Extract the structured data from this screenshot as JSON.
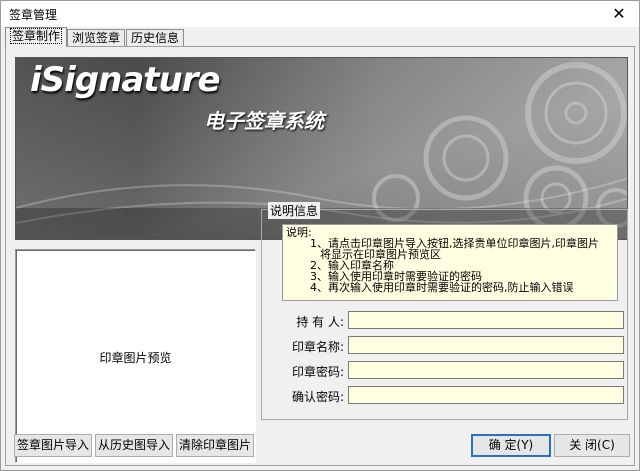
{
  "window": {
    "title": "签章管理",
    "close_glyph": "✕"
  },
  "tabs": [
    {
      "label": "签章制作",
      "active": true
    },
    {
      "label": "浏览签章",
      "active": false
    },
    {
      "label": "历史信息",
      "active": false
    }
  ],
  "banner": {
    "brand": "iSignature",
    "subtitle": "电子签章系统"
  },
  "preview": {
    "label": "印章图片预览"
  },
  "info": {
    "group_title": "说明信息",
    "note_lines": [
      "说明:",
      "1、请点击印章图片导入按钮,选择贵单位印章图片,印章图片",
      "将显示在印章图片预览区",
      "2、输入印章名称",
      "3、输入使用印章时需要验证的密码",
      "4、再次输入使用印章时需要验证的密码,防止输入错误"
    ],
    "fields": {
      "holder_label": "持 有 人:",
      "holder_value": "",
      "name_label": "印章名称:",
      "name_value": "",
      "password_label": "印章密码:",
      "password_value": "",
      "confirm_label": "确认密码:",
      "confirm_value": ""
    }
  },
  "buttons": {
    "import_image": "签章图片导入",
    "import_history": "从历史图导入",
    "clear_image": "清除印章图片",
    "ok": "确 定(Y)",
    "close": "关 闭(C)"
  },
  "colors": {
    "note_background": "#ffffe1",
    "primary_border": "#2a6fc4"
  }
}
